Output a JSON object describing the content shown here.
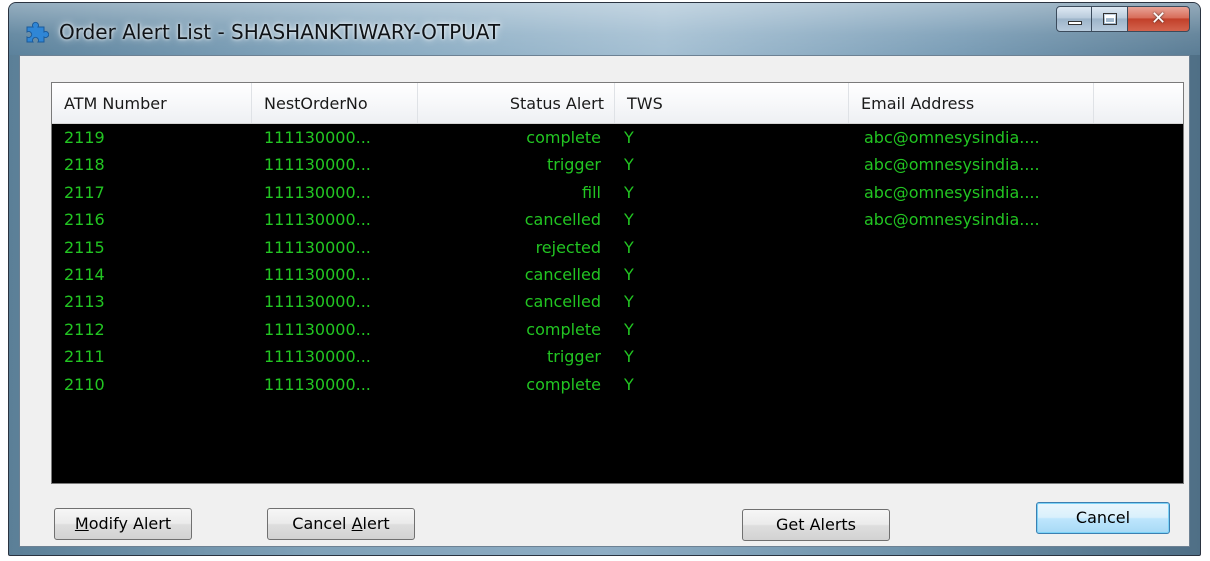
{
  "window": {
    "title": "Order Alert List - SHASHANKTIWARY-OTPUAT",
    "app_icon": "puzzle-piece-icon",
    "controls": {
      "minimize": "minimize-icon",
      "maximize": "maximize-icon",
      "close": "✕"
    }
  },
  "table": {
    "columns": [
      "ATM Number",
      "NestOrderNo",
      "Status Alert",
      "TWS",
      "Email Address"
    ],
    "text_color": "#22c522",
    "background": "#000000",
    "rows": [
      {
        "atm": "2119",
        "nest": "111130000...",
        "status": "complete",
        "tws": "Y",
        "email": "abc@omnesysindia...."
      },
      {
        "atm": "2118",
        "nest": "111130000...",
        "status": "trigger",
        "tws": "Y",
        "email": "abc@omnesysindia...."
      },
      {
        "atm": "2117",
        "nest": "111130000...",
        "status": "fill",
        "tws": "Y",
        "email": "abc@omnesysindia...."
      },
      {
        "atm": "2116",
        "nest": "111130000...",
        "status": "cancelled",
        "tws": "Y",
        "email": "abc@omnesysindia...."
      },
      {
        "atm": "2115",
        "nest": "111130000...",
        "status": "rejected",
        "tws": "Y",
        "email": ""
      },
      {
        "atm": "2114",
        "nest": "111130000...",
        "status": "cancelled",
        "tws": "Y",
        "email": ""
      },
      {
        "atm": "2113",
        "nest": "111130000...",
        "status": "cancelled",
        "tws": "Y",
        "email": ""
      },
      {
        "atm": "2112",
        "nest": "111130000...",
        "status": "complete",
        "tws": "Y",
        "email": ""
      },
      {
        "atm": "2111",
        "nest": "111130000...",
        "status": "trigger",
        "tws": "Y",
        "email": ""
      },
      {
        "atm": "2110",
        "nest": "111130000...",
        "status": "complete",
        "tws": "Y",
        "email": ""
      }
    ]
  },
  "buttons": {
    "modify_alert": {
      "pre": "",
      "accel": "M",
      "post": "odify Alert"
    },
    "cancel_alert": {
      "pre": "Cancel ",
      "accel": "A",
      "post": "lert"
    },
    "get_alerts": "Get Alerts",
    "cancel": "Cancel"
  }
}
